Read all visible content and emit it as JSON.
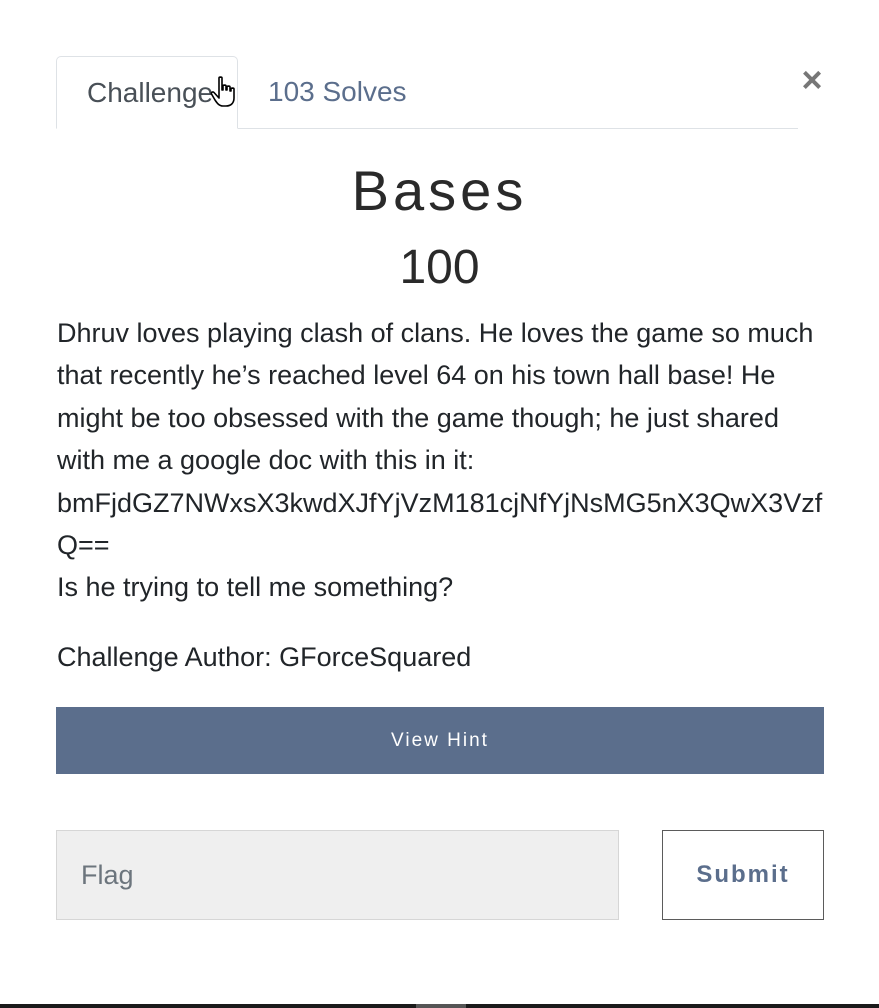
{
  "tabs": {
    "challenge_label": "Challenge",
    "solves_label": "103 Solves"
  },
  "close_label": "×",
  "challenge": {
    "name": "Bases",
    "points": "100",
    "description_line1": "Dhruv loves playing clash of clans. He loves the game so much that recently he’s reached level 64 on his town hall base! He might be too obsessed with the game though; he just shared with me a google doc with this in it:",
    "encoded_text": "bmFjdGZ7NWxsX3kwdXJfYjVzM181cjNfYjNsMG5nX3QwX3VzfQ==",
    "description_line3": "Is he trying to tell me something?",
    "author": "Challenge Author: GForceSquared"
  },
  "hint_button_label": "View Hint",
  "flag_input": {
    "placeholder": "Flag",
    "value": ""
  },
  "submit_label": "Submit",
  "colors": {
    "accent": "#5b6e8c",
    "input_bg": "#efefef"
  },
  "icons": {
    "cursor": "hand-pointer-icon",
    "close": "close-icon"
  }
}
